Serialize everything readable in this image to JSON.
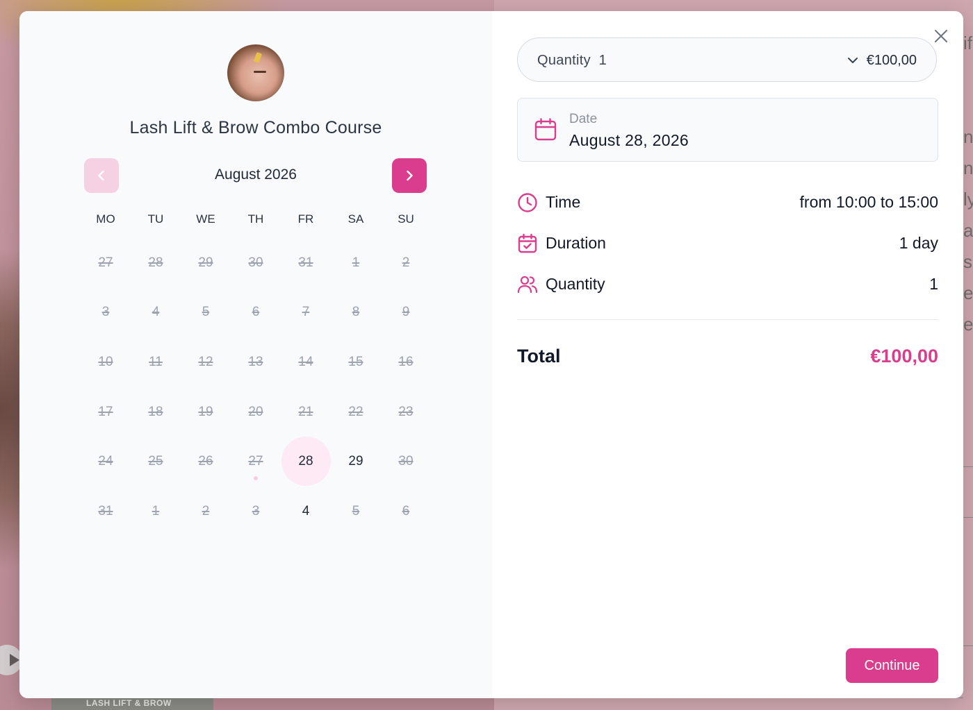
{
  "background": {
    "strip_text": "LASH LIFT & BROW",
    "edge_letters": [
      "if",
      "",
      "",
      "n",
      "n",
      "ly",
      "a",
      "s",
      "e",
      "e"
    ]
  },
  "course": {
    "title": "Lash Lift & Brow Combo Course"
  },
  "calendar": {
    "month_label": "August 2026",
    "prev_icon": "chevron-left-icon",
    "next_icon": "chevron-right-icon",
    "weekdays": [
      "MO",
      "TU",
      "WE",
      "TH",
      "FR",
      "SA",
      "SU"
    ],
    "days": [
      {
        "n": "27",
        "state": "disabled"
      },
      {
        "n": "28",
        "state": "disabled"
      },
      {
        "n": "29",
        "state": "disabled"
      },
      {
        "n": "30",
        "state": "disabled"
      },
      {
        "n": "31",
        "state": "disabled"
      },
      {
        "n": "1",
        "state": "disabled"
      },
      {
        "n": "2",
        "state": "disabled"
      },
      {
        "n": "3",
        "state": "disabled"
      },
      {
        "n": "4",
        "state": "disabled"
      },
      {
        "n": "5",
        "state": "disabled"
      },
      {
        "n": "6",
        "state": "disabled"
      },
      {
        "n": "7",
        "state": "disabled"
      },
      {
        "n": "8",
        "state": "disabled"
      },
      {
        "n": "9",
        "state": "disabled"
      },
      {
        "n": "10",
        "state": "disabled"
      },
      {
        "n": "11",
        "state": "disabled"
      },
      {
        "n": "12",
        "state": "disabled"
      },
      {
        "n": "13",
        "state": "disabled"
      },
      {
        "n": "14",
        "state": "disabled"
      },
      {
        "n": "15",
        "state": "disabled"
      },
      {
        "n": "16",
        "state": "disabled"
      },
      {
        "n": "17",
        "state": "disabled"
      },
      {
        "n": "18",
        "state": "disabled"
      },
      {
        "n": "19",
        "state": "disabled"
      },
      {
        "n": "20",
        "state": "disabled"
      },
      {
        "n": "21",
        "state": "disabled"
      },
      {
        "n": "22",
        "state": "disabled"
      },
      {
        "n": "23",
        "state": "disabled"
      },
      {
        "n": "24",
        "state": "disabled"
      },
      {
        "n": "25",
        "state": "disabled"
      },
      {
        "n": "26",
        "state": "disabled"
      },
      {
        "n": "27",
        "state": "disabled",
        "dot": true
      },
      {
        "n": "28",
        "state": "selected"
      },
      {
        "n": "29",
        "state": "available"
      },
      {
        "n": "30",
        "state": "disabled"
      },
      {
        "n": "31",
        "state": "disabled"
      },
      {
        "n": "1",
        "state": "disabled"
      },
      {
        "n": "2",
        "state": "disabled"
      },
      {
        "n": "3",
        "state": "disabled"
      },
      {
        "n": "4",
        "state": "available"
      },
      {
        "n": "5",
        "state": "disabled"
      },
      {
        "n": "6",
        "state": "disabled"
      }
    ]
  },
  "quantity_select": {
    "label": "Quantity  1",
    "price": "€100,00",
    "icon": "chevron-down-icon"
  },
  "date": {
    "caption": "Date",
    "value": "August 28, 2026",
    "icon": "calendar-icon"
  },
  "details": [
    {
      "icon": "clock-icon",
      "label": "Time",
      "value": "from 10:00 to 15:00"
    },
    {
      "icon": "calendar-check-icon",
      "label": "Duration",
      "value": "1 day"
    },
    {
      "icon": "users-icon",
      "label": "Quantity",
      "value": "1"
    }
  ],
  "total": {
    "label": "Total",
    "value": "€100,00"
  },
  "actions": {
    "continue_label": "Continue",
    "close_icon": "close-icon"
  },
  "colors": {
    "accent": "#db3d8e",
    "accent_light": "#f6d1e4",
    "selected_bg": "#fdeaf4",
    "text": "#111827",
    "muted": "#9ca3af"
  }
}
